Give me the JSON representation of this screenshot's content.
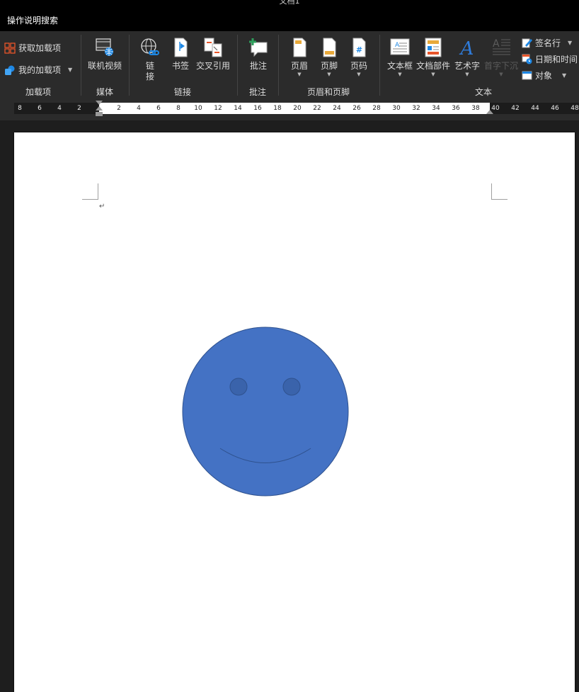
{
  "window": {
    "title": "文档1"
  },
  "tell_me": {
    "label": "操作说明搜索"
  },
  "ribbon": {
    "groups": [
      {
        "label": "加载项"
      },
      {
        "label": "媒体"
      },
      {
        "label": "链接"
      },
      {
        "label": "批注"
      },
      {
        "label": "页眉和页脚"
      },
      {
        "label": "文本"
      }
    ],
    "addins": {
      "get": "获取加载项",
      "mine": "我的加载项"
    },
    "media": {
      "online_video": "联机视频"
    },
    "links": {
      "link_top": "链",
      "link_bottom": "接",
      "bookmark": "书签",
      "cross_ref": "交叉引用"
    },
    "comments": {
      "comment": "批注"
    },
    "header_footer": {
      "header": "页眉",
      "footer": "页脚",
      "page_number": "页码"
    },
    "text": {
      "textbox": "文本框",
      "quick_parts": "文档部件",
      "wordart": "艺术字",
      "dropcap": "首字下沉",
      "signature": "签名行",
      "datetime": "日期和时间",
      "object": "对象"
    }
  },
  "ruler": {
    "labels": [
      "8",
      "6",
      "4",
      "2",
      "2",
      "4",
      "6",
      "8",
      "10",
      "12",
      "14",
      "16",
      "18",
      "20",
      "22",
      "24",
      "26",
      "28",
      "30",
      "32",
      "34",
      "36",
      "38",
      "40",
      "42",
      "44",
      "46",
      "48"
    ]
  },
  "document": {
    "paragraph_mark": "↵"
  },
  "colors": {
    "shape_fill": "#4472c4",
    "shape_stroke": "#2f528f",
    "accent_orange": "#e8552a",
    "ribbon_bg": "#2b2b2b"
  }
}
